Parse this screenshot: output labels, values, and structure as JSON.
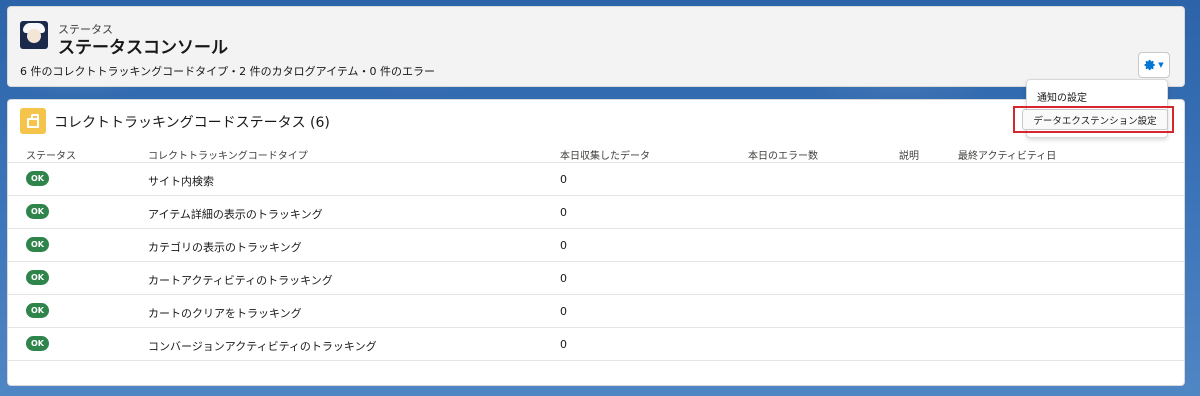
{
  "header": {
    "eyebrow": "ステータス",
    "title": "ステータスコンソール",
    "summary": "6 件のコレクトトラッキングコードタイプ・2 件のカタログアイテム・0 件のエラー",
    "settings_icon": "gear-icon"
  },
  "menu": {
    "items": [
      {
        "label": "通知の設定"
      },
      {
        "label": "データエクステンション設定"
      }
    ]
  },
  "section": {
    "icon": "box-icon",
    "title": "コレクトトラッキングコードステータス (6)"
  },
  "table": {
    "columns": [
      "ステータス",
      "コレクトトラッキングコードタイプ",
      "本日収集したデータ",
      "本日のエラー数",
      "説明",
      "最終アクティビティ日"
    ],
    "rows": [
      {
        "status": "OK",
        "type": "サイト内検索",
        "data": "0",
        "errors": "",
        "description": "",
        "last_activity": ""
      },
      {
        "status": "OK",
        "type": "アイテム詳細の表示のトラッキング",
        "data": "0",
        "errors": "",
        "description": "",
        "last_activity": ""
      },
      {
        "status": "OK",
        "type": "カテゴリの表示のトラッキング",
        "data": "0",
        "errors": "",
        "description": "",
        "last_activity": ""
      },
      {
        "status": "OK",
        "type": "カートアクティビティのトラッキング",
        "data": "0",
        "errors": "",
        "description": "",
        "last_activity": ""
      },
      {
        "status": "OK",
        "type": "カートのクリアをトラッキング",
        "data": "0",
        "errors": "",
        "description": "",
        "last_activity": ""
      },
      {
        "status": "OK",
        "type": "コンバージョンアクティビティのトラッキング",
        "data": "0",
        "errors": "",
        "description": "",
        "last_activity": ""
      }
    ]
  },
  "colors": {
    "ok_badge": "#2e844a",
    "accent": "#0176d3",
    "section_icon": "#f4c54a",
    "highlight": "#d6262e"
  }
}
